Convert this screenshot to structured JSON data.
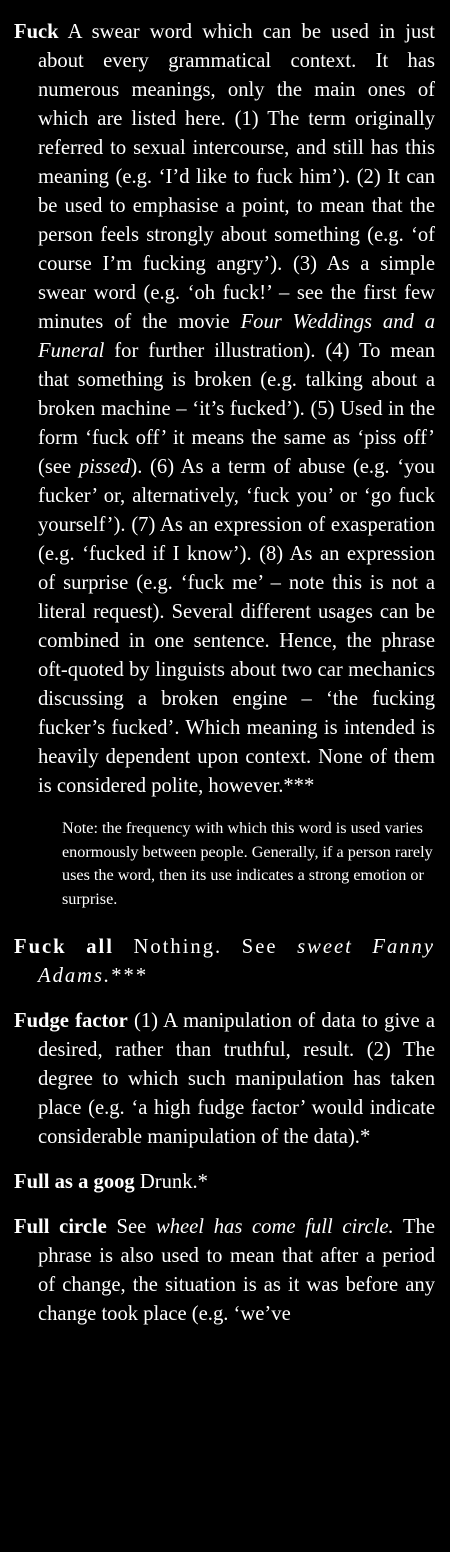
{
  "entries": [
    {
      "headword": "Fuck",
      "def_1": " A swear word which can be used in just about every grammatical context. It has numerous meanings, only the main ones of which are listed here. (1) The term originally referred to sexual intercourse, and still has this meaning (e.g. ‘I’d like to fuck him’). (2) It can be used to emphasise a point, to mean that the person feels strongly about something (e.g. ‘of course I’m fucking angry’). (3) As a simple swear word (e.g. ‘oh fuck!’ – see the first few minutes of the movie ",
      "italic_1": "Four Weddings and a Funeral",
      "def_2": " for further illustration). (4) To mean that something is broken (e.g. talking about a broken machine – ‘it’s fucked’). (5) Used in the form ‘fuck off’ it means the same as ‘piss off’ (see ",
      "italic_2": "pissed",
      "def_3": "). (6) As a term of abuse (e.g. ‘you fucker’ or, alternatively, ‘fuck you’ or ‘go fuck yourself’). (7) As an expression of exasperation (e.g. ‘fucked if I know’). (8) As an expression of surprise (e.g. ‘fuck me’ – note this is not a literal request). Several different usages can be combined in one sentence. Hence, the phrase oft-quoted by linguists about two car mechanics discussing a broken engine – ‘the fucking fucker’s fucked’. Which meaning is intended is heavily dependent upon context. None of them is considered polite, however.***",
      "note": "Note: the frequency with which this word is used varies enormously between people. Generally, if a person rarely uses the word, then its use indicates a strong emotion or surprise."
    },
    {
      "headword": "Fuck all",
      "def_1": " Nothing. See ",
      "italic_1": "sweet Fanny Adams.",
      "def_2": "***"
    },
    {
      "headword": "Fudge factor",
      "def_1": " (1) A manipulation of data to give a desired, rather than truthful, result. (2) The degree to which such manipulation has taken place (e.g. ‘a high fudge factor’ would indicate considerable manipulation of the data).*"
    },
    {
      "headword": "Full as a goog",
      "def_1": " Drunk.*"
    },
    {
      "headword": "Full circle",
      "def_1": " See ",
      "italic_1": "wheel has come full circle.",
      "def_2": " The phrase is also used to mean that after a period of change, the situation is as it was before any change took place (e.g. ‘we’ve"
    }
  ]
}
